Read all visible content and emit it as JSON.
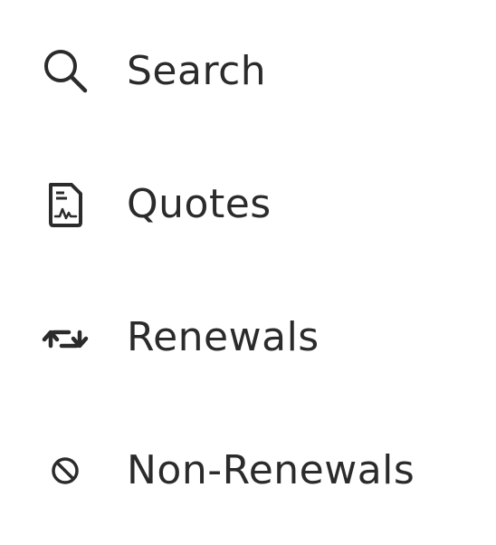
{
  "menu": {
    "items": [
      {
        "label": "Search",
        "icon": "search-icon"
      },
      {
        "label": "Quotes",
        "icon": "document-chart-icon"
      },
      {
        "label": "Renewals",
        "icon": "renew-arrows-icon"
      },
      {
        "label": "Non-Renewals",
        "icon": "prohibited-icon"
      }
    ]
  },
  "colors": {
    "text": "#2b2b2b",
    "background": "#ffffff"
  }
}
